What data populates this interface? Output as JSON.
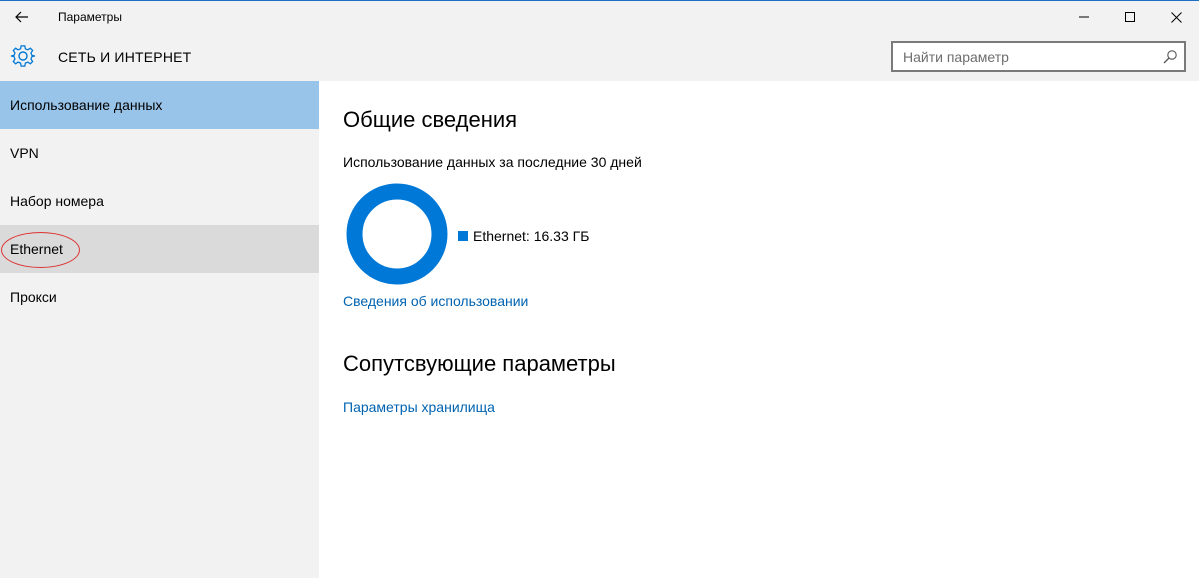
{
  "window": {
    "title": "Параметры"
  },
  "header": {
    "section_title": "СЕТЬ И ИНТЕРНЕТ",
    "search_placeholder": "Найти параметр"
  },
  "sidebar": {
    "items": [
      {
        "label": "Использование данных",
        "state": "selected"
      },
      {
        "label": "VPN",
        "state": "normal"
      },
      {
        "label": "Набор номера",
        "state": "normal"
      },
      {
        "label": "Ethernet",
        "state": "hover"
      },
      {
        "label": "Прокси",
        "state": "normal"
      }
    ]
  },
  "main": {
    "overview_heading": "Общие сведения",
    "usage_subtitle": "Использование данных за последние 30 дней",
    "legend_entry": "Ethernet: 16.33 ГБ",
    "usage_details_link": "Сведения об использовании",
    "related_heading": "Сопутсвующие параметры",
    "storage_link": "Параметры хранилища"
  },
  "colors": {
    "accent": "#0078d7",
    "selected_item": "#99c4ea",
    "hover_item": "#dadada",
    "link": "#0063b1",
    "annotation": "#dd3333"
  }
}
